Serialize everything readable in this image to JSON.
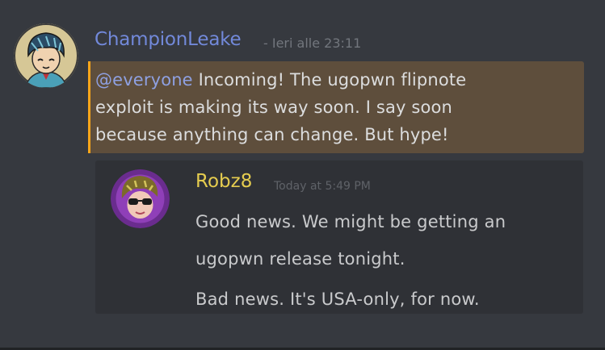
{
  "message": {
    "author": "ChampionLeake",
    "timestamp": "- Ieri alle 23:11",
    "mention": "@everyone",
    "lines": [
      " Incoming! The ugopwn flipnote",
      "exploit is making its way soon. I say soon",
      "because anything can change. But hype!"
    ],
    "avatar_icon": "cartoon-avatar-icon"
  },
  "quoted": {
    "author": "Robz8",
    "timestamp": "Today at 5:49 PM",
    "lines": [
      "Good news. We might be getting an",
      "ugopwn release tonight.",
      "Bad news. It's USA-only, for now."
    ],
    "avatar_icon": "cartoon-avatar-icon"
  },
  "colors": {
    "background": "#36393f",
    "mention_highlight": "#5e4e3c",
    "mention_bar": "#faa61a",
    "author_blue": "#7289da",
    "author_yellow": "#e5cc4f",
    "embed_bg": "#2f3136"
  }
}
